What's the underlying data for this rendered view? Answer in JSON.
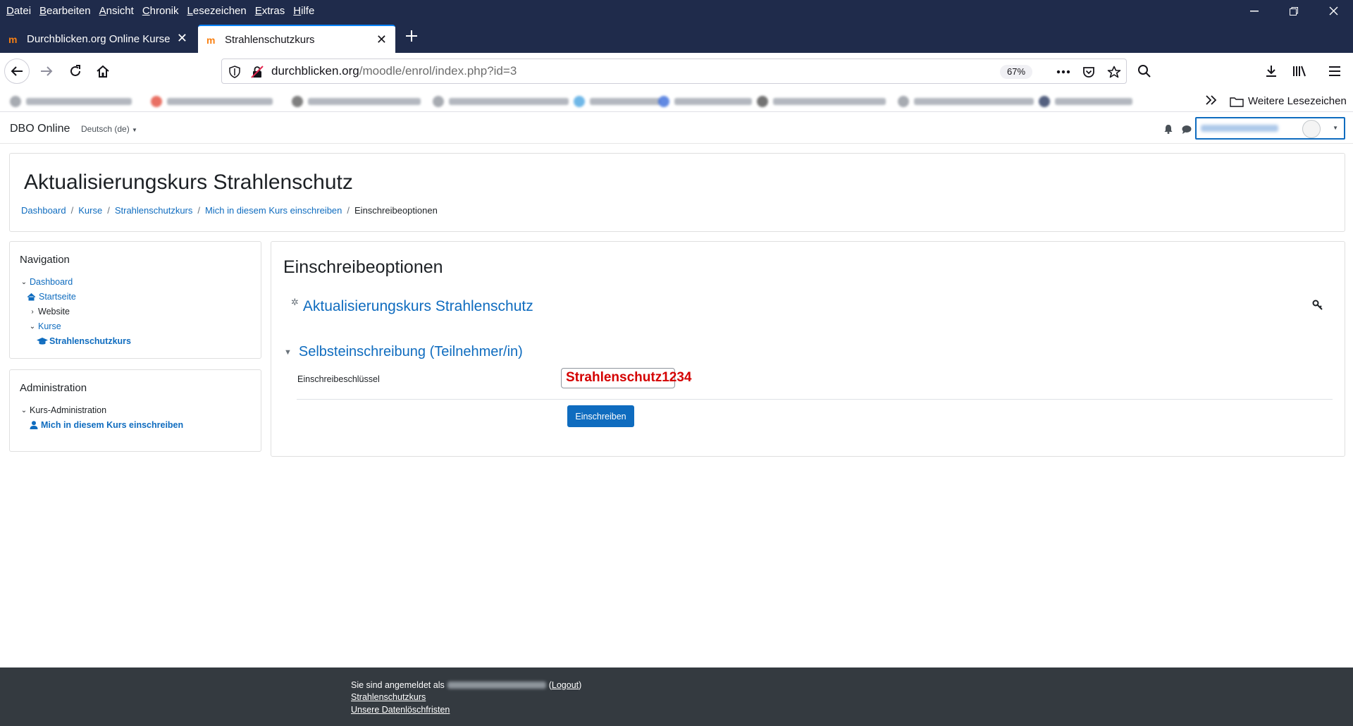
{
  "browser": {
    "menu": [
      "Datei",
      "Bearbeiten",
      "Ansicht",
      "Chronik",
      "Lesezeichen",
      "Extras",
      "Hilfe"
    ],
    "tabs": [
      {
        "title": "Durchblicken.org Online Kurse",
        "active": false
      },
      {
        "title": "Strahlenschutzkurs",
        "active": true
      }
    ],
    "url": {
      "host": "durchblicken.org",
      "path": "/moodle/enrol/index.php?id=3"
    },
    "zoom": "67%",
    "bookmarks_more_label": "Weitere Lesezeichen"
  },
  "moodle": {
    "brand": "DBO Online",
    "language": "Deutsch (de)",
    "page_title": "Aktualisierungskurs Strahlenschutz",
    "breadcrumb": [
      "Dashboard",
      "Kurse",
      "Strahlenschutzkurs",
      "Mich in diesem Kurs einschreiben"
    ],
    "breadcrumb_current": "Einschreibeoptionen",
    "navigation": {
      "title": "Navigation",
      "dashboard": "Dashboard",
      "home": "Startseite",
      "website": "Website",
      "courses": "Kurse",
      "course": "Strahlenschutzkurs"
    },
    "administration": {
      "title": "Administration",
      "course_admin": "Kurs-Administration",
      "enrol_me": "Mich in diesem Kurs einschreiben"
    },
    "main": {
      "heading": "Einschreibeoptionen",
      "course_name": "Aktualisierungskurs Strahlenschutz",
      "section_heading": "Selbsteinschreibung (Teilnehmer/in)",
      "field_label": "Einschreibeschlüssel",
      "enrolment_key": "Strahlenschutz1234",
      "submit_label": "Einschreiben"
    },
    "footer": {
      "logged_in_prefix": "Sie sind angemeldet als",
      "logout": "Logout",
      "course_link": "Strahlenschutzkurs",
      "privacy_link": "Unsere Datenlöschfristen"
    }
  },
  "colors": {
    "chrome": "#1f2b4b",
    "primary": "#0f6cbf",
    "key_text": "#d40000",
    "footer": "#343a40"
  }
}
